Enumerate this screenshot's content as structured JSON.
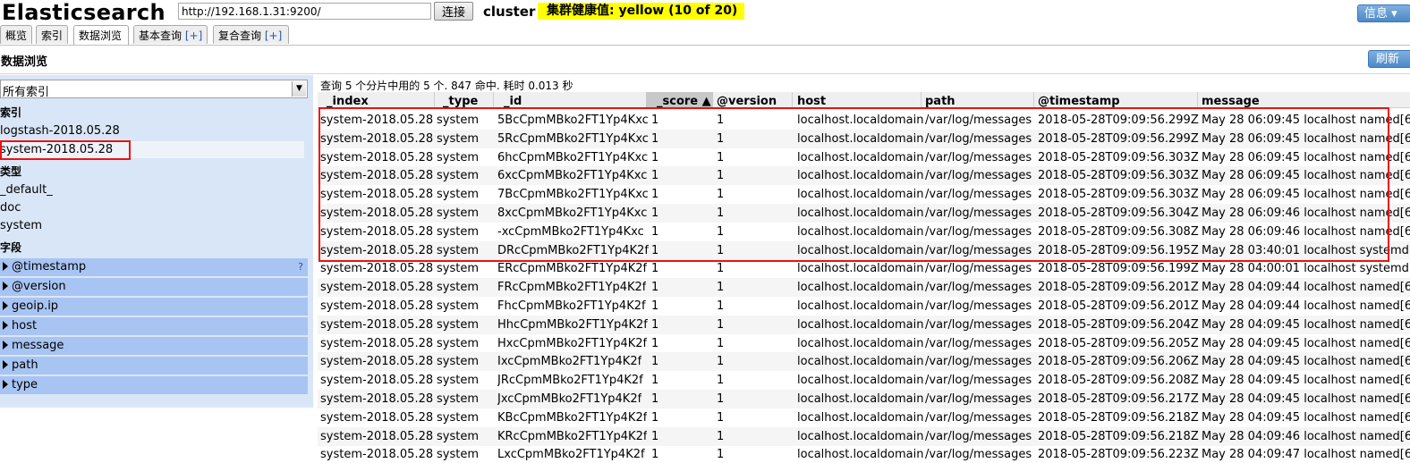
{
  "header": {
    "app_title": "Elasticsearch",
    "url_value": "http://192.168.1.31:9200/",
    "connect_label": "连接",
    "cluster_name": "cluster",
    "cluster_health": "集群健康值: yellow (10 of 20)",
    "info_label": "信息 ▾"
  },
  "tabs": [
    {
      "label": "概览"
    },
    {
      "label": "索引"
    },
    {
      "label": "数据浏览"
    },
    {
      "label": "基本查询",
      "plus": "[+]"
    },
    {
      "label": "复合查询",
      "plus": "[+]"
    }
  ],
  "section": {
    "title": "数据浏览",
    "refresh_label": "刷新"
  },
  "sidebar": {
    "index_select_value": "所有索引",
    "indices_heading": "索引",
    "indices": [
      "logstash-2018.05.28",
      "system-2018.05.28"
    ],
    "types_heading": "类型",
    "types": [
      "_default_",
      "doc",
      "system"
    ],
    "fields_heading": "字段",
    "fields": [
      "@timestamp",
      "@version",
      "geoip.ip",
      "host",
      "message",
      "path",
      "type"
    ],
    "help_mark": "?"
  },
  "results": {
    "summary": "查询 5 个分片中用的 5 个. 847 命中. 耗时 0.013 秒",
    "columns": [
      "_index",
      "_type",
      "_id",
      "_score ▲",
      "@version",
      "host",
      "path",
      "@timestamp",
      "message"
    ],
    "rows": [
      [
        "system-2018.05.28",
        "system",
        "5BcCpmMBko2FT1Yp4Kxc",
        "1",
        "1",
        "localhost.localdomain",
        "/var/log/messages",
        "2018-05-28T09:09:56.299Z",
        "May 28 06:09:45 localhost named[6"
      ],
      [
        "system-2018.05.28",
        "system",
        "5RcCpmMBko2FT1Yp4Kxc",
        "1",
        "1",
        "localhost.localdomain",
        "/var/log/messages",
        "2018-05-28T09:09:56.299Z",
        "May 28 06:09:45 localhost named[6"
      ],
      [
        "system-2018.05.28",
        "system",
        "6hcCpmMBko2FT1Yp4Kxc",
        "1",
        "1",
        "localhost.localdomain",
        "/var/log/messages",
        "2018-05-28T09:09:56.303Z",
        "May 28 06:09:45 localhost named[6"
      ],
      [
        "system-2018.05.28",
        "system",
        "6xcCpmMBko2FT1Yp4Kxc",
        "1",
        "1",
        "localhost.localdomain",
        "/var/log/messages",
        "2018-05-28T09:09:56.303Z",
        "May 28 06:09:45 localhost named[6"
      ],
      [
        "system-2018.05.28",
        "system",
        "7BcCpmMBko2FT1Yp4Kxc",
        "1",
        "1",
        "localhost.localdomain",
        "/var/log/messages",
        "2018-05-28T09:09:56.303Z",
        "May 28 06:09:45 localhost named[6"
      ],
      [
        "system-2018.05.28",
        "system",
        "8xcCpmMBko2FT1Yp4Kxc",
        "1",
        "1",
        "localhost.localdomain",
        "/var/log/messages",
        "2018-05-28T09:09:56.304Z",
        "May 28 06:09:46 localhost named[6"
      ],
      [
        "system-2018.05.28",
        "system",
        "-xcCpmMBko2FT1Yp4Kxc",
        "1",
        "1",
        "localhost.localdomain",
        "/var/log/messages",
        "2018-05-28T09:09:56.308Z",
        "May 28 06:09:46 localhost named[6"
      ],
      [
        "system-2018.05.28",
        "system",
        "DRcCpmMBko2FT1Yp4K2f",
        "1",
        "1",
        "localhost.localdomain",
        "/var/log/messages",
        "2018-05-28T09:09:56.195Z",
        "May 28 03:40:01 localhost systemd"
      ],
      [
        "system-2018.05.28",
        "system",
        "ERcCpmMBko2FT1Yp4K2f",
        "1",
        "1",
        "localhost.localdomain",
        "/var/log/messages",
        "2018-05-28T09:09:56.199Z",
        "May 28 04:00:01 localhost systemd["
      ],
      [
        "system-2018.05.28",
        "system",
        "FRcCpmMBko2FT1Yp4K2f",
        "1",
        "1",
        "localhost.localdomain",
        "/var/log/messages",
        "2018-05-28T09:09:56.201Z",
        "May 28 04:09:44 localhost named[6"
      ],
      [
        "system-2018.05.28",
        "system",
        "FhcCpmMBko2FT1Yp4K2f",
        "1",
        "1",
        "localhost.localdomain",
        "/var/log/messages",
        "2018-05-28T09:09:56.201Z",
        "May 28 04:09:44 localhost named[6"
      ],
      [
        "system-2018.05.28",
        "system",
        "HhcCpmMBko2FT1Yp4K2f",
        "1",
        "1",
        "localhost.localdomain",
        "/var/log/messages",
        "2018-05-28T09:09:56.204Z",
        "May 28 04:09:45 localhost named[6"
      ],
      [
        "system-2018.05.28",
        "system",
        "HxcCpmMBko2FT1Yp4K2f",
        "1",
        "1",
        "localhost.localdomain",
        "/var/log/messages",
        "2018-05-28T09:09:56.205Z",
        "May 28 04:09:45 localhost named[6"
      ],
      [
        "system-2018.05.28",
        "system",
        "IxcCpmMBko2FT1Yp4K2f",
        "1",
        "1",
        "localhost.localdomain",
        "/var/log/messages",
        "2018-05-28T09:09:56.206Z",
        "May 28 04:09:45 localhost named[6"
      ],
      [
        "system-2018.05.28",
        "system",
        "JRcCpmMBko2FT1Yp4K2f",
        "1",
        "1",
        "localhost.localdomain",
        "/var/log/messages",
        "2018-05-28T09:09:56.208Z",
        "May 28 04:09:45 localhost named[6"
      ],
      [
        "system-2018.05.28",
        "system",
        "JxcCpmMBko2FT1Yp4K2f",
        "1",
        "1",
        "localhost.localdomain",
        "/var/log/messages",
        "2018-05-28T09:09:56.217Z",
        "May 28 04:09:45 localhost named[6"
      ],
      [
        "system-2018.05.28",
        "system",
        "KBcCpmMBko2FT1Yp4K2f",
        "1",
        "1",
        "localhost.localdomain",
        "/var/log/messages",
        "2018-05-28T09:09:56.218Z",
        "May 28 04:09:45 localhost named[6"
      ],
      [
        "system-2018.05.28",
        "system",
        "KRcCpmMBko2FT1Yp4K2f",
        "1",
        "1",
        "localhost.localdomain",
        "/var/log/messages",
        "2018-05-28T09:09:56.218Z",
        "May 28 04:09:46 localhost named[6"
      ],
      [
        "system-2018.05.28",
        "system",
        "LxcCpmMBko2FT1Yp4K2f",
        "1",
        "1",
        "localhost.localdomain",
        "/var/log/messages",
        "2018-05-28T09:09:56.223Z",
        "May 28 04:09:47 localhost named[6"
      ]
    ]
  },
  "colors": {
    "health_yellow": "#ffff00",
    "sidebar_bg": "#d9e6f7",
    "field_row_bg": "#a8c4f2",
    "button_blue": "#5a92d0",
    "annotation_red": "#ee1111"
  }
}
